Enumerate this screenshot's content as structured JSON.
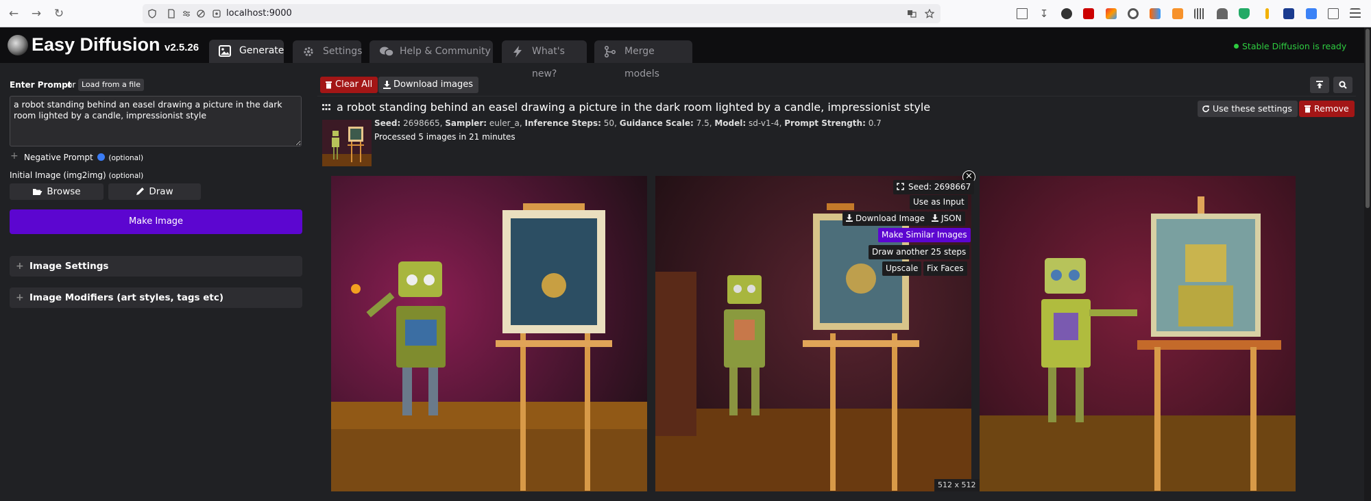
{
  "browser": {
    "url": "localhost:9000"
  },
  "app": {
    "title": "Easy Diffusion",
    "version": "v2.5.26",
    "status": "Stable Diffusion is ready",
    "accent_color": "#5c06d0",
    "status_color": "#2ecc40"
  },
  "tabs": [
    {
      "label": "Generate",
      "icon": "image-icon",
      "active": true
    },
    {
      "label": "Settings",
      "icon": "gear-icon"
    },
    {
      "label": "Help & Community",
      "icon": "comments-icon"
    },
    {
      "label": "What's new?",
      "icon": "bolt-icon"
    },
    {
      "label": "Merge models",
      "icon": "code-merge-icon"
    }
  ],
  "left": {
    "enter_prompt_label": "Enter Prompt",
    "or_text": "or",
    "load_file_label": "Load from a file",
    "prompt_value": "a robot standing behind an easel drawing a picture in the dark room lighted by a candle, impressionist style",
    "negative_prompt_label": "Negative Prompt",
    "optional": "(optional)",
    "initial_image_label": "Initial Image (img2img)",
    "browse_label": "Browse",
    "draw_label": "Draw",
    "make_image_label": "Make Image",
    "image_settings_label": "Image Settings",
    "image_modifiers_label": "Image Modifiers (art styles, tags etc)"
  },
  "toolbar": {
    "clear_all_label": "Clear All",
    "download_images_label": "Download images"
  },
  "task": {
    "title": "a robot standing behind an easel drawing a picture in the dark room lighted by a candle, impressionist style",
    "use_settings_label": "Use these settings",
    "remove_label": "Remove",
    "seed_key": "Seed:",
    "seed_val": "2698665,",
    "sampler_key": "Sampler:",
    "sampler_val": "euler_a,",
    "steps_key": "Inference Steps:",
    "steps_val": "50,",
    "guidance_key": "Guidance Scale:",
    "guidance_val": "7.5,",
    "model_key": "Model:",
    "model_val": "sd-v1-4,",
    "strength_key": "Prompt Strength:",
    "strength_val": "0.7",
    "processed": "Processed 5 images in 21 minutes"
  },
  "overlay": {
    "seed": "Seed: 2698667",
    "use_as_input": "Use as Input",
    "download_image": "Download Image",
    "json": "JSON",
    "make_similar": "Make Similar Images",
    "draw_more": "Draw another 25 steps",
    "upscale": "Upscale",
    "fix_faces": "Fix Faces",
    "size": "512 x 512"
  }
}
